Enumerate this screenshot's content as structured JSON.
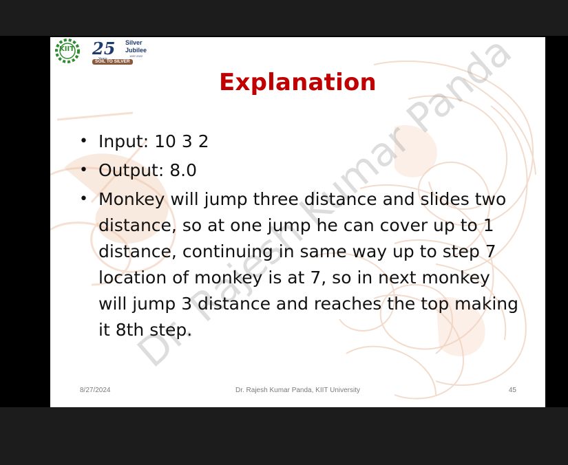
{
  "slide": {
    "logo": {
      "kiit": "KIIT",
      "number": "25",
      "years": "Years",
      "silver": "Silver",
      "jubilee": "Jubilee",
      "dates": "1997-2022",
      "tagline": "SOIL TO SILVER"
    },
    "title": "Explanation",
    "bullets": [
      "Input: 10 3 2",
      "Output: 8.0",
      "Monkey will jump three distance and slides two distance, so at one jump he can cover up to 1 distance, continuing in same way up to step 7 location of monkey is at 7, so in next monkey will jump 3 distance and reaches the top making it 8th step."
    ],
    "watermark": "Dr. Rajesh Kumar Panda",
    "footer": {
      "date": "8/27/2024",
      "author": "Dr. Rajesh Kumar Panda, KIIT University",
      "page": "45"
    }
  },
  "colors": {
    "title": "#c00000",
    "frame": "#1c1c1c",
    "accent_swirl": "#e8b89a"
  }
}
